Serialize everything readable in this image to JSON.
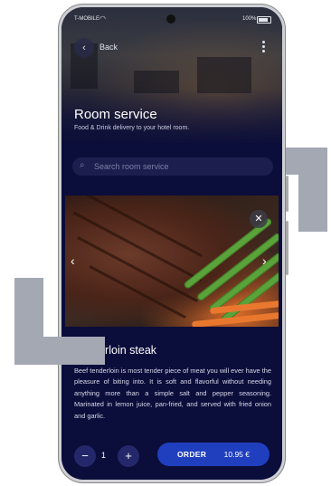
{
  "status_bar": {
    "carrier": "T-MOBILE",
    "battery": "100%"
  },
  "header": {
    "back_label": "Back",
    "title": "Room service",
    "subtitle": "Food & Drink delivery to your hotel room."
  },
  "search": {
    "placeholder": "Search room service"
  },
  "dish": {
    "title": "Tenderloin steak",
    "description": "Beef tenderloin is most tender piece of meat you will ever have the pleasure of biting into. It is soft and flavorful without needing anything more than a simple salt and pepper seasoning. Marinated in lemon juice, pan-fried, and served with fried onion and garlic."
  },
  "order": {
    "quantity": "1",
    "button_label": "ORDER",
    "price": "10.95 €"
  },
  "icons": {
    "back": "chevron-left-icon",
    "more": "more-vertical-icon",
    "search": "search-icon",
    "close": "close-icon",
    "prev": "chevron-left-icon",
    "next": "chevron-right-icon"
  },
  "colors": {
    "background": "#0b0d3a",
    "accent": "#1f3fbf",
    "bracket": "#a3a8b3"
  }
}
